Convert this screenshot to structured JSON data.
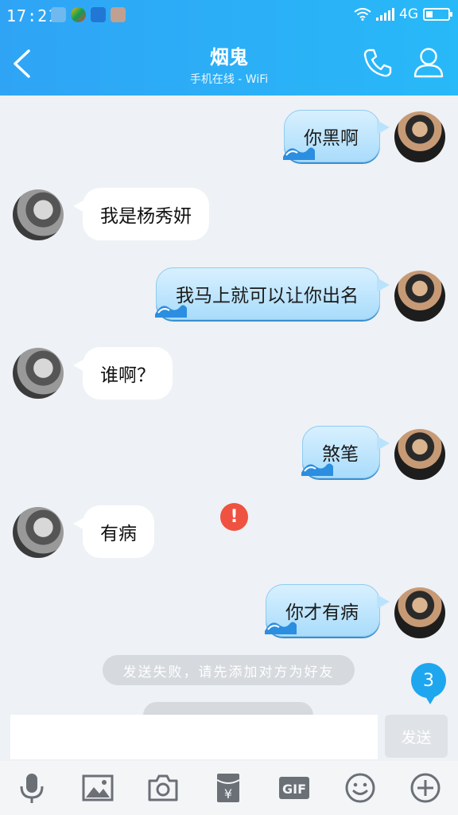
{
  "status": {
    "time": "17:21",
    "network": "4G"
  },
  "header": {
    "title": "烟鬼",
    "subtitle": "手机在线 - WiFi"
  },
  "messages": [
    {
      "side": "out",
      "text": "你黑啊"
    },
    {
      "side": "in",
      "text": "我是杨秀妍"
    },
    {
      "side": "out",
      "text": "我马上就可以让你出名"
    },
    {
      "side": "in",
      "text": "谁啊？"
    },
    {
      "side": "out",
      "text": "煞笔"
    },
    {
      "side": "in",
      "text": "有病"
    },
    {
      "side": "out",
      "text": "你才有病",
      "failed": true
    }
  ],
  "error_mark": "!",
  "system_message": "发送失败，请先添加对方为好友",
  "unread_count": "3",
  "composer": {
    "send_label": "发送"
  },
  "toolbar": [
    "mic-icon",
    "image-icon",
    "camera-icon",
    "red-packet-icon",
    "gif-icon",
    "emoji-icon",
    "plus-icon"
  ],
  "colors": {
    "header": "#2fa4f5",
    "error": "#ef5240",
    "unread": "#1ea6ef"
  }
}
